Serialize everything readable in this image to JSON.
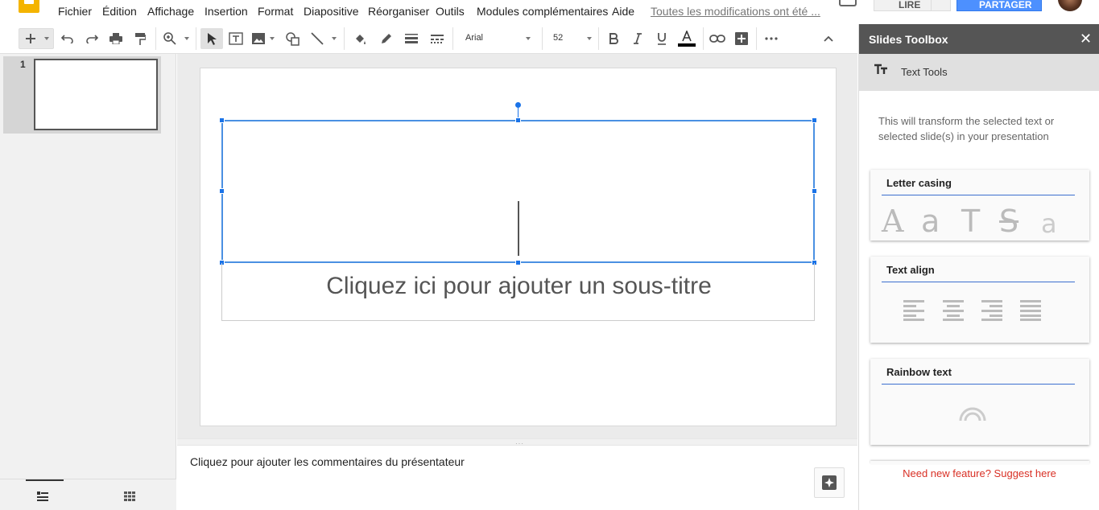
{
  "menu": {
    "items": [
      "Fichier",
      "Édition",
      "Affichage",
      "Insertion",
      "Format",
      "Diapositive",
      "Réorganiser",
      "Outils",
      "Modules complémentaires",
      "Aide"
    ],
    "save_status": "Toutes les modifications ont été ...",
    "read_button": "LIRE",
    "share_button": "PARTAGER"
  },
  "toolbar": {
    "font_name": "Arial",
    "font_size": "52"
  },
  "filmstrip": {
    "slides": [
      {
        "number": "1"
      }
    ]
  },
  "slide": {
    "subtitle_placeholder": "Cliquez ici pour ajouter un sous-titre"
  },
  "notes": {
    "placeholder": "Cliquez pour ajouter les commentaires du présentateur"
  },
  "sidebar": {
    "title": "Slides Toolbox",
    "close": "✕",
    "section": "Text Tools",
    "description": "This will transform the selected text or selected slide(s) in your presentation",
    "cards": {
      "casing": "Letter casing",
      "align": "Text align",
      "rainbow": "Rainbow text"
    },
    "casing_glyphs": [
      "A",
      "a",
      "T",
      "S",
      "a"
    ],
    "suggest": "Need new feature? Suggest here"
  },
  "colors": {
    "accent": "#1a73e8",
    "sidebar_header": "#555555",
    "logo": "#f4b400",
    "share": "#4d90fe",
    "suggest_link": "#d93025"
  }
}
